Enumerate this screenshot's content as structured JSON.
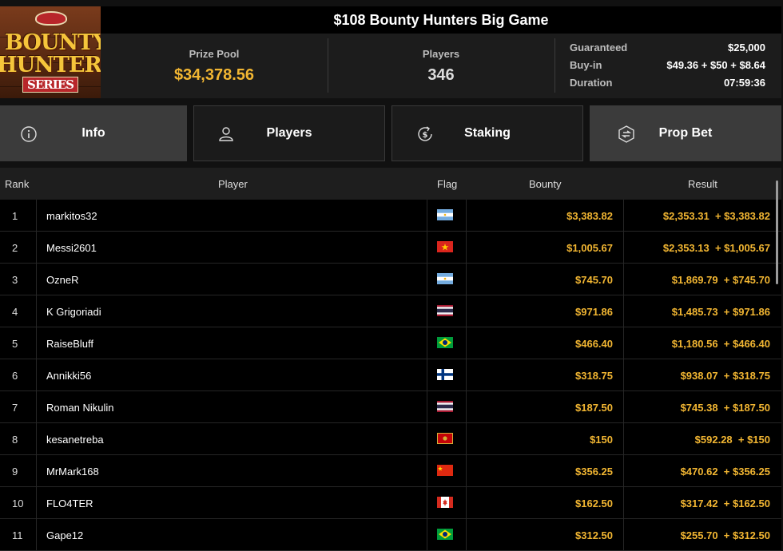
{
  "logo": {
    "word1": "BOUNTY",
    "word2": "HUNTERS",
    "word3": "SERIES"
  },
  "header": {
    "title": "$108 Bounty Hunters Big Game"
  },
  "stats": {
    "prize_pool_label": "Prize Pool",
    "prize_pool_value": "$34,378.56",
    "players_label": "Players",
    "players_value": "346"
  },
  "details": [
    {
      "label": "Guaranteed",
      "value": "$25,000"
    },
    {
      "label": "Buy-in",
      "value": "$49.36 + $50 + $8.64"
    },
    {
      "label": "Duration",
      "value": "07:59:36"
    }
  ],
  "tabs": [
    {
      "label": "Info",
      "icon": "info-icon"
    },
    {
      "label": "Players",
      "icon": "user-icon"
    },
    {
      "label": "Staking",
      "icon": "dollar-circle-icon"
    },
    {
      "label": "Prop Bet",
      "icon": "prop-bet-icon"
    }
  ],
  "table": {
    "columns": {
      "rank": "Rank",
      "player": "Player",
      "flag": "Flag",
      "bounty": "Bounty",
      "result": "Result"
    },
    "rows": [
      {
        "rank": "1",
        "player": "markitos32",
        "country": "argentina",
        "bounty": "$3,383.82",
        "result": "$2,353.31  + $3,383.82"
      },
      {
        "rank": "2",
        "player": "Messi2601",
        "country": "vietnam",
        "bounty": "$1,005.67",
        "result": "$2,353.13  + $1,005.67"
      },
      {
        "rank": "3",
        "player": "OzneR",
        "country": "argentina",
        "bounty": "$745.70",
        "result": "$1,869.79  + $745.70"
      },
      {
        "rank": "4",
        "player": "K Grigoriadi",
        "country": "thailand",
        "bounty": "$971.86",
        "result": "$1,485.73  + $971.86"
      },
      {
        "rank": "5",
        "player": "RaiseBluff",
        "country": "brazil",
        "bounty": "$466.40",
        "result": "$1,180.56  + $466.40"
      },
      {
        "rank": "6",
        "player": "Annikki56",
        "country": "finland",
        "bounty": "$318.75",
        "result": "$938.07  + $318.75"
      },
      {
        "rank": "7",
        "player": "Roman Nikulin",
        "country": "thailand",
        "bounty": "$187.50",
        "result": "$745.38  + $187.50"
      },
      {
        "rank": "8",
        "player": "kesanetreba",
        "country": "montenegro",
        "bounty": "$150",
        "result": "$592.28  + $150"
      },
      {
        "rank": "9",
        "player": "MrMark168",
        "country": "china",
        "bounty": "$356.25",
        "result": "$470.62  + $356.25"
      },
      {
        "rank": "10",
        "player": "FLO4TER",
        "country": "canada",
        "bounty": "$162.50",
        "result": "$317.42  + $162.50"
      },
      {
        "rank": "11",
        "player": "Gape12",
        "country": "brazil",
        "bounty": "$312.50",
        "result": "$255.70  + $312.50"
      }
    ]
  },
  "colors": {
    "accent": "#f2b632",
    "active_tab": "#3b3b3b",
    "row_bg": "#000000"
  }
}
